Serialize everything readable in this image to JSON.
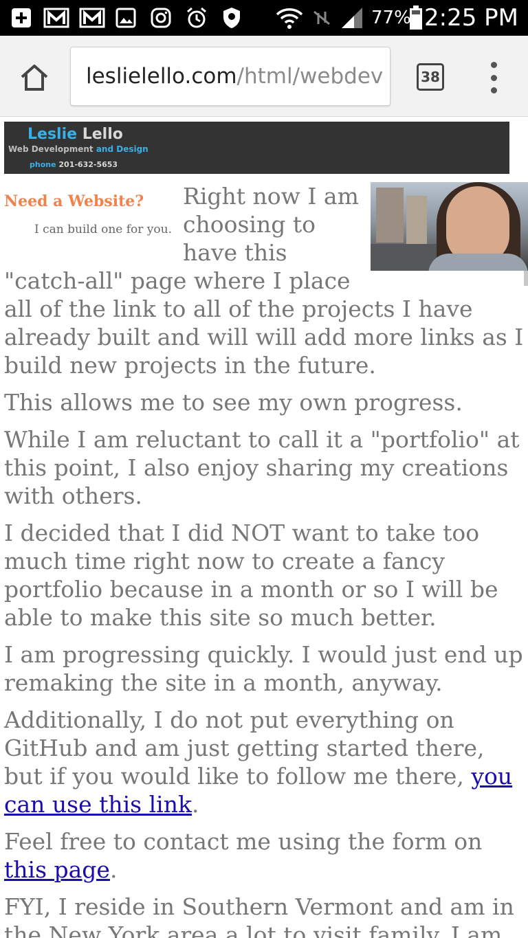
{
  "status_bar": {
    "battery_percent": "77%",
    "time": "2:25 PM",
    "icons": [
      "add-icon",
      "gmail-icon",
      "gmail-icon",
      "image-icon",
      "instagram-icon",
      "alarm-icon",
      "shield-icon",
      "wifi-icon",
      "no-data-icon",
      "signal-icon",
      "battery-icon"
    ]
  },
  "browser": {
    "url_domain": "leslielello.com",
    "url_path": "/html/webdev",
    "tab_count": "38"
  },
  "banner": {
    "first_name": "Leslie",
    "last_name": "Lello",
    "tagline_part1": "Web Development ",
    "tagline_part2": "and Design",
    "phone_label": "phone ",
    "phone_number": "201-632-5653"
  },
  "aside": {
    "title": "Need a Website?",
    "subtitle": "I can build one for you."
  },
  "paragraphs": [
    "Right now I am choosing to have this \"catch-all\" page where I place all of the link to all of the projects I have already built and will will add more links as I build new projects in the future.",
    "This allows me to see my own progress.",
    "While I am reluctant to call it a \"portfolio\" at this point, I also enjoy sharing my creations with others.",
    "I decided that I did NOT want to take too much time right now to create a fancy portfolio because in a month or so I will be able to make this site so much better.",
    "I am progressing quickly. I would just end up remaking the site in a month, anyway."
  ],
  "github_paragraph": {
    "text": "Additionally, I do not put everything on GitHub and am just getting started there, but if you would like to follow me there, ",
    "link": "you can use this link",
    "after": "."
  },
  "contact_paragraph": {
    "text": "Feel free to contact me using the form on ",
    "link": "this page",
    "after": "."
  },
  "last_paragraph": "FYI, I reside in Southern Vermont and am in the New York area a lot to visit family. I am"
}
